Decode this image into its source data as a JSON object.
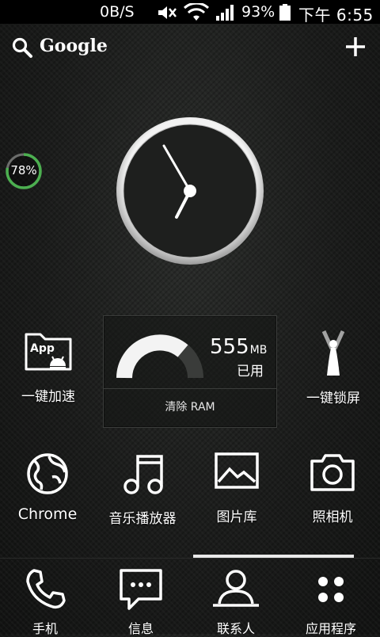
{
  "status_bar": {
    "net_speed": "0B/S",
    "battery_percent": "93%",
    "time": "下午 6:55",
    "icons": [
      "mute-icon",
      "wifi-icon",
      "signal-icon",
      "battery-icon"
    ]
  },
  "search_bar": {
    "label": "Google",
    "icons": [
      "search-icon",
      "add-icon"
    ]
  },
  "memory_ring": {
    "label": "78%",
    "percent": 78,
    "color": "#4caf50"
  },
  "clock": {
    "icon": "analog-clock"
  },
  "row1": {
    "boost": {
      "label": "一键加速",
      "icon": "app-folder-android-icon"
    },
    "lock": {
      "label": "一键锁屏",
      "icon": "fairy-icon"
    }
  },
  "ram_widget": {
    "value": "555",
    "unit": "MB",
    "used_label": "已用",
    "clear_label": "清除 RAM"
  },
  "row2": [
    {
      "label": "Chrome",
      "icon": "globe-icon"
    },
    {
      "label": "音乐播放器",
      "icon": "music-note-icon"
    },
    {
      "label": "图片库",
      "icon": "gallery-icon"
    },
    {
      "label": "照相机",
      "icon": "camera-icon"
    }
  ],
  "dock": [
    {
      "label": "手机",
      "icon": "phone-icon"
    },
    {
      "label": "信息",
      "icon": "message-icon"
    },
    {
      "label": "联系人",
      "icon": "contact-icon"
    },
    {
      "label": "应用程序",
      "icon": "apps-grid-icon"
    }
  ]
}
